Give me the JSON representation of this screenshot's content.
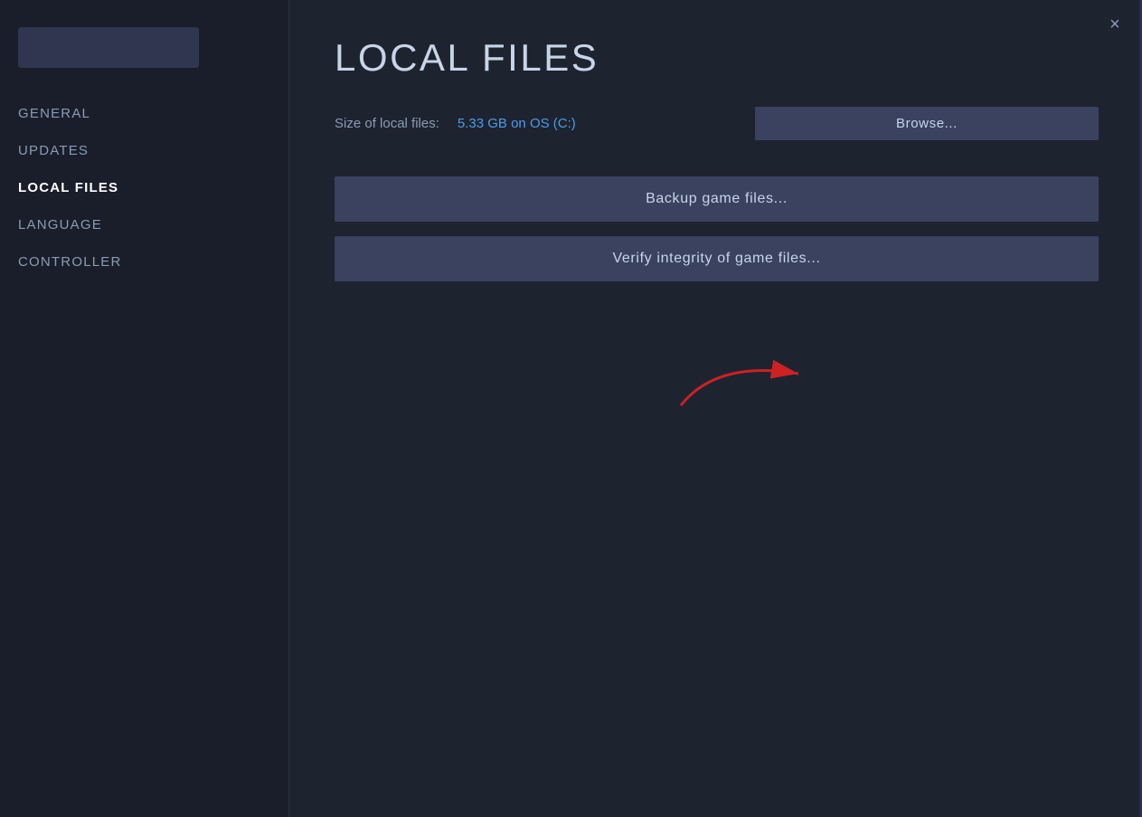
{
  "dialog": {
    "title": "LOCAL FILES",
    "close_icon": "×"
  },
  "sidebar": {
    "game_title_blurred": true,
    "nav_items": [
      {
        "id": "general",
        "label": "GENERAL",
        "active": false
      },
      {
        "id": "updates",
        "label": "UPDATES",
        "active": false
      },
      {
        "id": "local-files",
        "label": "LOCAL FILES",
        "active": true
      },
      {
        "id": "language",
        "label": "LANGUAGE",
        "active": false
      },
      {
        "id": "controller",
        "label": "CONTROLLER",
        "active": false
      }
    ]
  },
  "main": {
    "page_title": "LOCAL FILES",
    "file_size_label": "Size of local files:",
    "file_size_value": "5.33 GB on OS (C:)",
    "browse_button_label": "Browse...",
    "backup_button_label": "Backup game files...",
    "verify_button_label": "Verify integrity of game files..."
  },
  "colors": {
    "accent_blue": "#4a9de8",
    "button_bg": "#3a4260",
    "sidebar_bg": "#1a1e2a",
    "main_bg": "#1e2330"
  }
}
